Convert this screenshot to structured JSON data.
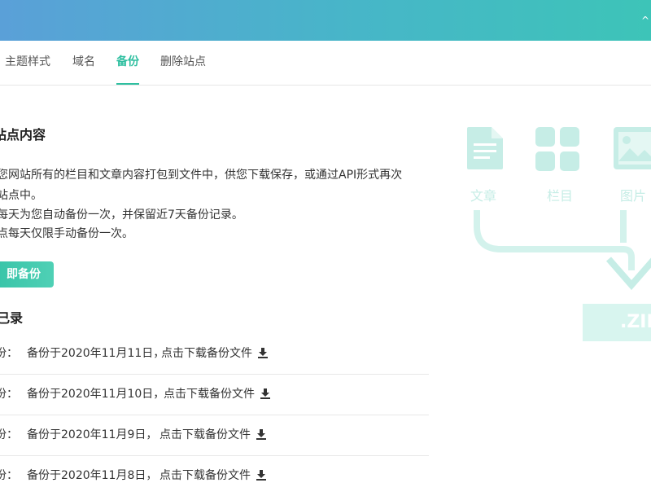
{
  "header": {
    "corner_mark": "^"
  },
  "tabs": [
    {
      "label": "主题样式",
      "active": false
    },
    {
      "label": "域名",
      "active": false
    },
    {
      "label": "备份",
      "active": true
    },
    {
      "label": "删除站点",
      "active": false
    }
  ],
  "section": {
    "title": "站点内容",
    "lines": [
      "您网站所有的栏目和文章内容打包到文件中，供您下载保存，或通过API形式再次",
      "站点中。",
      "每天为您自动备份一次，并保留近7天备份记录。",
      "点每天仅限手动备份一次。"
    ],
    "backup_button": "即备份"
  },
  "records": {
    "title": "己录",
    "rows": [
      {
        "label": "份：",
        "date": "备份于2020年11月11日，",
        "link": "点击下载备份文件"
      },
      {
        "label": "份：",
        "date": "备份于2020年11月10日，",
        "link": "点击下载备份文件"
      },
      {
        "label": "份：",
        "date": "备份于2020年11月9日，",
        "link": "点击下载备份文件"
      },
      {
        "label": "份：",
        "date": "备份于2020年11月8日，",
        "link": "点击下载备份文件"
      }
    ]
  },
  "illustration": {
    "labels": [
      "文章",
      "栏目",
      "图片"
    ],
    "zip_label": ".ZIP",
    "accent_color": "#c6ede6"
  },
  "colors": {
    "accent": "#2fbfa0",
    "header_start": "#5aa0d8",
    "header_end": "#3dc4b8"
  }
}
